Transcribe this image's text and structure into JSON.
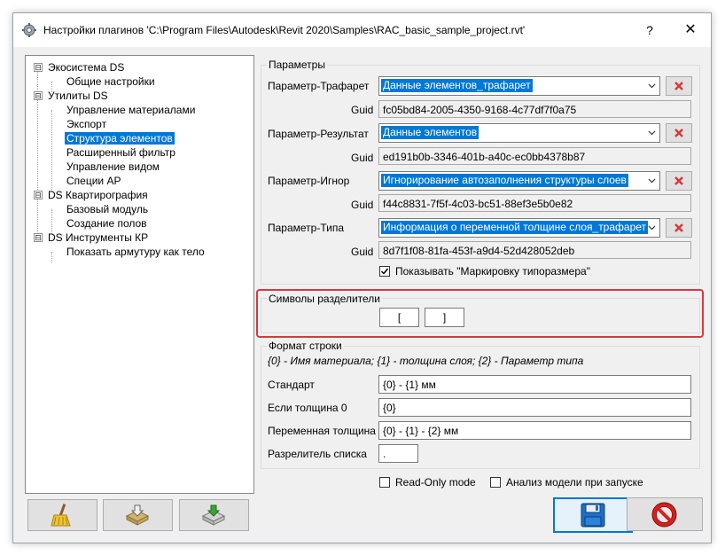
{
  "window": {
    "title": "Настройки плагинов 'C:\\Program Files\\Autodesk\\Revit 2020\\Samples\\RAC_basic_sample_project.rvt'",
    "help": "?",
    "close": "✕"
  },
  "tree": {
    "items": [
      {
        "label": "Экосистема DS",
        "expander": "⊟"
      },
      {
        "label": "Общие настройки"
      },
      {
        "label": "Утилиты DS",
        "expander": "⊟"
      },
      {
        "label": "Управление материалами"
      },
      {
        "label": "Экспорт"
      },
      {
        "label": "Структура элементов",
        "selected": true
      },
      {
        "label": "Расширенный фильтр"
      },
      {
        "label": "Управление видом"
      },
      {
        "label": "Специи АР"
      },
      {
        "label": "DS Квартирография",
        "expander": "⊟"
      },
      {
        "label": "Базовый модуль"
      },
      {
        "label": "Создание полов"
      },
      {
        "label": "DS Инструменты КР",
        "expander": "⊟"
      },
      {
        "label": "Показать армутуру как тело"
      }
    ]
  },
  "params": {
    "group_title": "Параметры",
    "guid_label": "Guid",
    "rows": [
      {
        "label": "Параметр-Трафарет",
        "value": "Данные элементов_трафарет",
        "guid": "fc05bd84-2005-4350-9168-4c77df7f0a75"
      },
      {
        "label": "Параметр-Результат",
        "value": "Данные элементов",
        "guid": "ed191b0b-3346-401b-a40c-ec0bb4378b87"
      },
      {
        "label": "Параметр-Игнор",
        "value": "Игнорирование автозаполнения структуры слоев",
        "guid": "f44c8831-7f5f-4c03-bc51-88ef3e5b0e82"
      },
      {
        "label": "Параметр-Типа",
        "value": "Информация о переменной толщине слоя_трафарет",
        "guid": "8d7f1f08-81fa-453f-a9d4-52d428052deb"
      }
    ],
    "show_marking_label": "Показывать \"Маркировку типоразмера\"",
    "show_marking_checked": true
  },
  "separators": {
    "group_title": "Символы разделители",
    "open": "[",
    "close": "]"
  },
  "format": {
    "group_title": "Формат строки",
    "hint": "{0} - Имя материала; {1} - толщина слоя; {2} - Параметр типа",
    "standard_label": "Стандарт",
    "standard_value": "{0} - {1} мм",
    "zero_label": "Если толщина 0",
    "zero_value": "{0}",
    "variable_label": "Переменная толщина",
    "variable_value": "{0} - {1} - {2} мм",
    "list_sep_label": "Разрелитель списка",
    "list_sep_value": "."
  },
  "options": {
    "readonly_label": "Read-Only mode",
    "readonly_checked": false,
    "analyze_label": "Анализ модели при запуске",
    "analyze_checked": false
  },
  "colors": {
    "selection": "#0078d7",
    "highlight": "#d9383a",
    "clear_x": "#d9383a"
  },
  "icons": {
    "clean": "broom-icon",
    "import": "import-icon",
    "export": "export-icon",
    "save": "floppy-disk-icon",
    "cancel": "no-entry-icon"
  }
}
